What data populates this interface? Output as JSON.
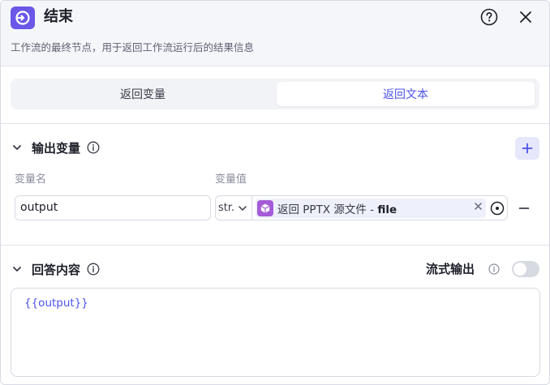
{
  "header": {
    "title": "结束",
    "description": "工作流的最终节点，用于返回工作流运行后的结果信息",
    "icon": "end-node-icon",
    "accent_color": "#6a57e8"
  },
  "tabs": [
    {
      "label": "返回变量",
      "active": false
    },
    {
      "label": "返回文本",
      "active": true
    }
  ],
  "output_section": {
    "title": "输出变量",
    "columns": {
      "name": "变量名",
      "value": "变量值"
    },
    "rows": [
      {
        "name": "output",
        "type": "str.",
        "reference": {
          "prefix": "返回 PPTX 源文件 -",
          "field": "file"
        }
      }
    ]
  },
  "answer_section": {
    "title": "回答内容",
    "stream_label": "流式输出",
    "stream_enabled": false,
    "content": "{{output}}"
  },
  "colors": {
    "primary": "#4d53e8",
    "reference_icon": "#a45bd8"
  }
}
